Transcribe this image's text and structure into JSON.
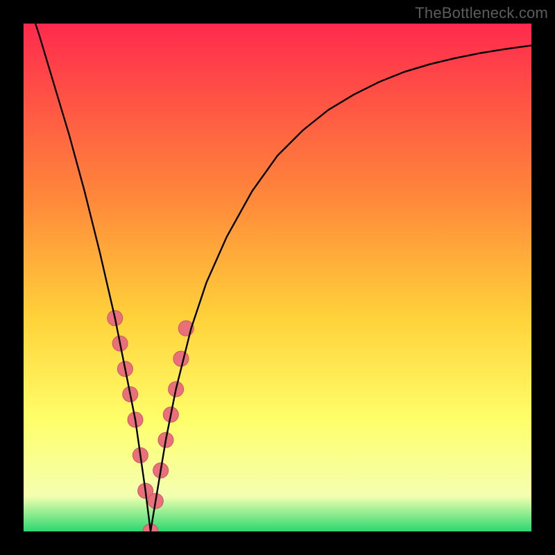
{
  "watermark": "TheBottleneck.com",
  "colors": {
    "frame": "#000000",
    "grad_top": "#ff2a4d",
    "grad_mid1": "#ff8a3a",
    "grad_mid2": "#ffd23a",
    "grad_mid3": "#ffff6a",
    "grad_mid4": "#f4ffb0",
    "grad_bottom": "#2bd86f",
    "curve": "#000000",
    "marker_fill": "#e96f7a",
    "marker_stroke": "#c85863"
  },
  "chart_data": {
    "type": "line",
    "title": "",
    "xlabel": "",
    "ylabel": "",
    "xlim": [
      0,
      100
    ],
    "ylim": [
      0,
      100
    ],
    "x_min_at": 25,
    "series": [
      {
        "name": "bottleneck-curve",
        "x": [
          0,
          3,
          6,
          9,
          12,
          15,
          18,
          20,
          22,
          23,
          24,
          25,
          26,
          27,
          28,
          30,
          33,
          36,
          40,
          45,
          50,
          55,
          60,
          65,
          70,
          75,
          80,
          85,
          90,
          95,
          100
        ],
        "y": [
          107,
          98,
          88,
          78,
          67,
          55,
          42,
          32,
          22,
          15,
          8,
          0,
          6,
          12,
          18,
          28,
          40,
          49,
          58,
          67,
          74,
          79,
          83,
          86,
          88.5,
          90.5,
          92,
          93.2,
          94.2,
          95,
          95.7
        ]
      }
    ],
    "markers": {
      "name": "highlighted-range",
      "x": [
        18,
        19,
        20,
        21,
        22,
        23,
        24,
        25,
        26,
        27,
        28,
        29,
        30,
        31,
        32
      ],
      "y": [
        42,
        37,
        32,
        27,
        22,
        15,
        8,
        0,
        6,
        12,
        18,
        23,
        28,
        34,
        40
      ]
    }
  }
}
